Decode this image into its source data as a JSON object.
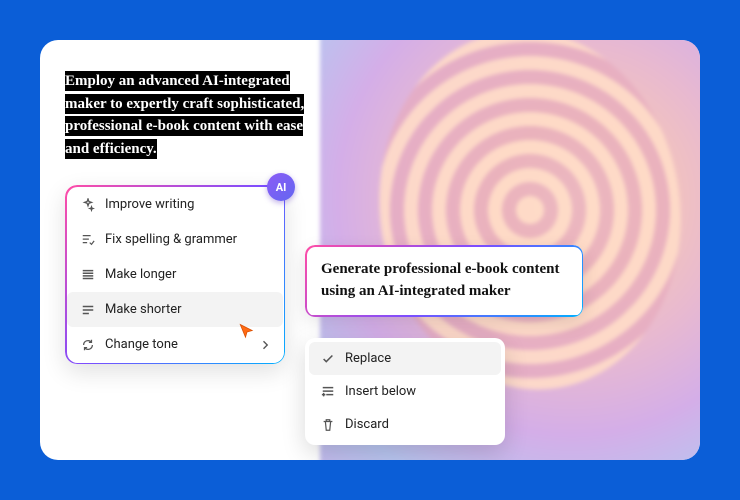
{
  "highlighted_text": "Employ an advanced AI-integrated maker to expertly craft sophisticated, professional e-book content with ease and efficiency.",
  "ai_badge": "AI",
  "ai_menu": {
    "items": [
      {
        "label": "Improve writing"
      },
      {
        "label": "Fix spelling & grammer"
      },
      {
        "label": "Make longer"
      },
      {
        "label": "Make shorter"
      },
      {
        "label": "Change tone"
      }
    ]
  },
  "result_text": "Generate professional e-book content using an AI-integrated maker",
  "action_menu": {
    "items": [
      {
        "label": "Replace"
      },
      {
        "label": "Insert below"
      },
      {
        "label": "Discard"
      }
    ]
  }
}
